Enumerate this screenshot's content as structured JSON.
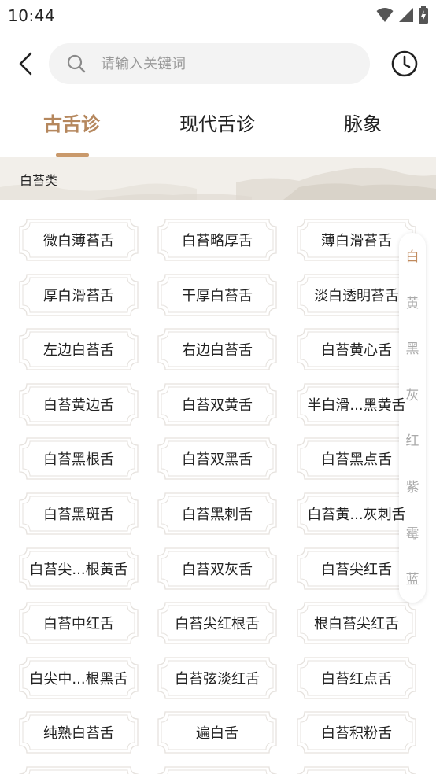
{
  "status": {
    "time": "10:44"
  },
  "search": {
    "placeholder": "请输入关键词"
  },
  "tabs": [
    {
      "label": "古舌诊",
      "active": true
    },
    {
      "label": "现代舌诊",
      "active": false
    },
    {
      "label": "脉象",
      "active": false
    }
  ],
  "category": {
    "label": "白苔类"
  },
  "items": [
    "微白薄苔舌",
    "白苔略厚舌",
    "薄白滑苔舌",
    "厚白滑苔舌",
    "干厚白苔舌",
    "淡白透明苔舌",
    "左边白苔舌",
    "右边白苔舌",
    "白苔黄心舌",
    "白苔黄边舌",
    "白苔双黄舌",
    "半白滑...黑黄舌",
    "白苔黑根舌",
    "白苔双黑舌",
    "白苔黑点舌",
    "白苔黑斑舌",
    "白苔黑刺舌",
    "白苔黄...灰刺舌",
    "白苔尖...根黄舌",
    "白苔双灰舌",
    "白苔尖红舌",
    "白苔中红舌",
    "白苔尖红根舌",
    "根白苔尖红舌",
    "白尖中...根黑舌",
    "白苔弦淡红舌",
    "白苔红点舌",
    "纯熟白苔舌",
    "遍白舌",
    "白苔积粉舌"
  ],
  "side_index": [
    "白",
    "黄",
    "黑",
    "灰",
    "红",
    "紫",
    "霉",
    "蓝"
  ],
  "colors": {
    "accent": "#b5875d",
    "chip_border": "#e6e2de",
    "banner_bg": "#f2efea"
  },
  "icons": {
    "back": "chevron-left-icon",
    "search": "search-icon",
    "history": "clock-icon"
  }
}
